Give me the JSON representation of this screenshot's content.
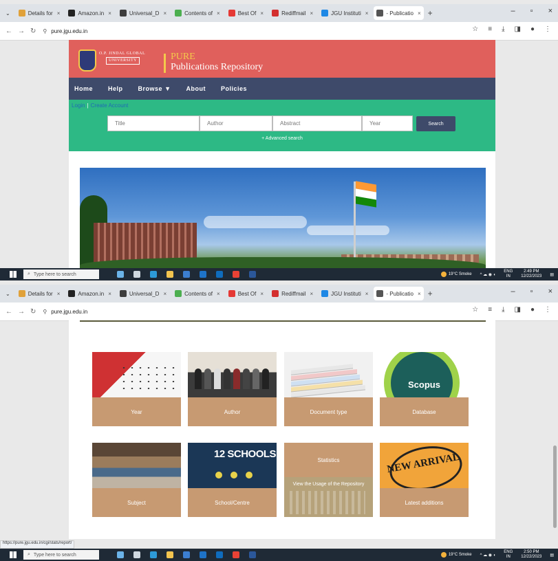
{
  "browser": {
    "tabs": [
      {
        "label": "Details for",
        "color": "#e0a13a"
      },
      {
        "label": "Amazon.in",
        "color": "#222222"
      },
      {
        "label": "Universal_D",
        "color": "#3d3d3d"
      },
      {
        "label": "Contents of",
        "color": "#4caf50"
      },
      {
        "label": "Best Of",
        "color": "#e53935"
      },
      {
        "label": "Rediffmail",
        "color": "#d32f2f"
      },
      {
        "label": "JGU Instituti",
        "color": "#1e88e5"
      },
      {
        "label": "- Publicatio",
        "color": "#555555",
        "active": true
      }
    ],
    "url": "pure.jgu.edu.in",
    "status_url": "https://pure.jgu.edu.in/cgi/stats/report/"
  },
  "site": {
    "logo_line1": "O.P. JINDAL GLOBAL",
    "logo_line2": "UNIVERSITY",
    "pure": "PURE",
    "repo": "Publications Repository"
  },
  "nav": {
    "home": "Home",
    "help": "Help",
    "browse": "Browse",
    "about": "About",
    "policies": "Policies"
  },
  "auth": {
    "login": "Login",
    "create": "Create Account"
  },
  "search": {
    "title": "Title",
    "author": "Author",
    "abstract": "Abstract",
    "year": "Year",
    "button": "Search",
    "advanced": "+ Advanced search"
  },
  "cards": {
    "year": "Year",
    "author": "Author",
    "doctype": "Document type",
    "database": "Database",
    "scopus": "Scopus",
    "schools": "12 SCHOOLS",
    "subject": "Subject",
    "school": "School/Centre",
    "statistics": "Statistics",
    "usage": "View the Usage of the Repository",
    "latest": "Latest additions",
    "new_arrival": "NEW ARRIVAL"
  },
  "taskbar": {
    "search": "Type here to search",
    "weather": "19°C Smoke",
    "lang": "ENG",
    "region": "IN",
    "time1": "2:49 PM",
    "date": "12/22/2023",
    "time2": "2:50 PM"
  }
}
